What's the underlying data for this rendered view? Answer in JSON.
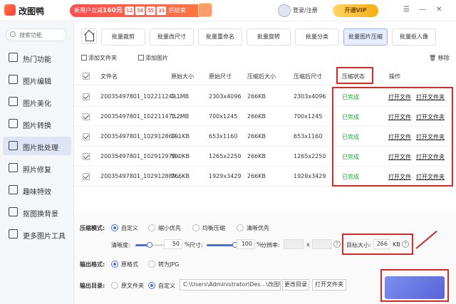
{
  "app": {
    "name": "改图鸭",
    "promo_text": "新用户立减",
    "promo_amount": "160元",
    "countdown": [
      "12",
      "58",
      "55",
      "33"
    ],
    "promo_end": "后结束",
    "login": "登录/注册",
    "vip": "开通VIP"
  },
  "sidebar": {
    "search_placeholder": "搜索功能",
    "items": [
      {
        "label": "热门功能",
        "icon": "fire-icon"
      },
      {
        "label": "图片编辑",
        "icon": "edit-icon"
      },
      {
        "label": "图片美化",
        "icon": "beautify-icon"
      },
      {
        "label": "图片转换",
        "icon": "convert-icon"
      },
      {
        "label": "图片批处理",
        "icon": "batch-icon"
      },
      {
        "label": "照片修复",
        "icon": "repair-icon"
      },
      {
        "label": "趣味特效",
        "icon": "effect-icon"
      },
      {
        "label": "抠图换背景",
        "icon": "cutout-icon"
      },
      {
        "label": "更多图片工具",
        "icon": "tools-icon"
      }
    ]
  },
  "tabs": [
    "批量裁剪",
    "批量改尺寸",
    "批量重命名",
    "批量旋转",
    "批量分类",
    "批量图片压缩",
    "批量抠人像"
  ],
  "actions": {
    "add_folder": "添加文件夹",
    "add_image": "添加图片",
    "remove": "移除"
  },
  "table": {
    "headers": [
      "文件名",
      "原始大小",
      "原始尺寸",
      "压缩后大小",
      "压缩后尺寸",
      "压缩状态",
      "操作"
    ],
    "rows": [
      {
        "name": "20035497801_102211249...",
        "size": "1.1MB",
        "dim": "2303x4096",
        "csize": "266KB",
        "cdim": "2303x4096",
        "status": "已完成",
        "op1": "打开文件",
        "op2": "打开文件夹"
      },
      {
        "name": "20035497801_102211473...",
        "size": "1.2MB",
        "dim": "700x1245",
        "csize": "266KB",
        "cdim": "700x1245",
        "status": "已完成",
        "op1": "打开文件",
        "op2": "打开文件夹"
      },
      {
        "name": "20035497801_102912869...",
        "size": "191KB",
        "dim": "653x1160",
        "csize": "266KB",
        "cdim": "653x1160",
        "status": "已完成",
        "op1": "打开文件",
        "op2": "打开文件夹"
      },
      {
        "name": "20035497801_102912978...",
        "size": "590KB",
        "dim": "1265x2250",
        "csize": "266KB",
        "cdim": "1265x2250",
        "status": "已完成",
        "op1": "打开文件",
        "op2": "打开文件夹"
      },
      {
        "name": "20035497801_102912889...",
        "size": "766KB",
        "dim": "1929x3429",
        "csize": "266KB",
        "cdim": "1929x3429",
        "status": "已完成",
        "op1": "打开文件",
        "op2": "打开文件夹"
      }
    ]
  },
  "settings": {
    "mode_label": "压缩模式:",
    "modes": [
      "自定义",
      "缩小优先",
      "均衡压缩",
      "清晰优先"
    ],
    "clarity_label": "清晰度:",
    "clarity_value": "50",
    "clarity_unit": "%",
    "size_label": "尺寸:",
    "size_value": "100",
    "size_unit": "%",
    "resolution_label": "分辨率:",
    "res_x": "x",
    "target_label": "目标大小:",
    "target_value": "266",
    "target_unit": "KB",
    "format_label": "输出格式:",
    "formats": [
      "原格式",
      "转为JPG"
    ],
    "dir_label": "输出目录:",
    "dirs": [
      "原文件夹",
      "自定义"
    ],
    "path": "C:\\Users\\Administrator\\Des...\\改图鸭",
    "change_dir": "更改目录",
    "open_folder": "打开文件夹",
    "clarity_fraction": 0.5,
    "size_fraction": 1.0
  }
}
